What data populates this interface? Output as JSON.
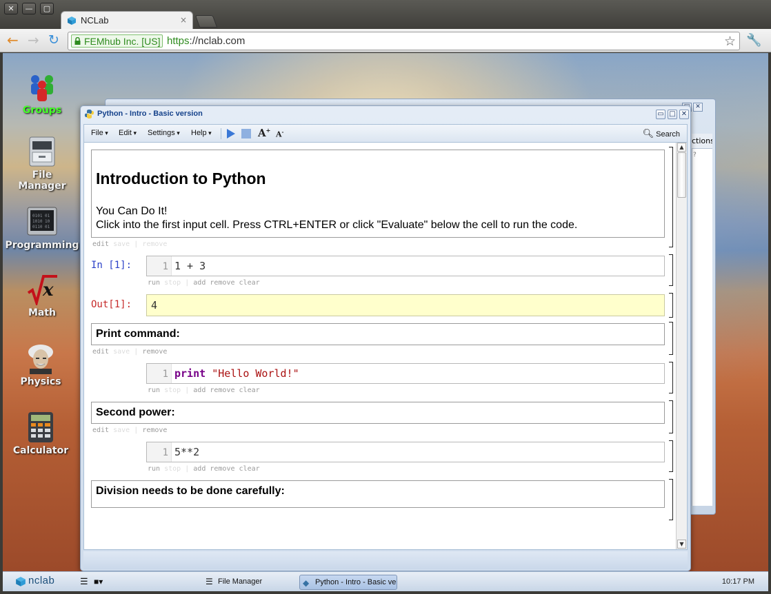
{
  "browser": {
    "tab_title": "NCLab",
    "tab_close": "×",
    "ev_label": "FEMhub Inc. [US]",
    "url_scheme": "https",
    "url_rest": "://nclab.com",
    "window_controls": [
      "✕",
      "—",
      "▢"
    ]
  },
  "desktop": {
    "icons": [
      {
        "label": "Groups",
        "icon": "groups-icon"
      },
      {
        "label": "File\nManager",
        "icon": "file-cabinet-icon"
      },
      {
        "label": "Programming",
        "icon": "terminal-icon"
      },
      {
        "label": "Math",
        "icon": "sqrt-x-icon"
      },
      {
        "label": "Physics",
        "icon": "einstein-icon"
      },
      {
        "label": "Calculator",
        "icon": "calculator-icon"
      }
    ],
    "back_window_header": "ctions",
    "back_window_sub": "?"
  },
  "window": {
    "title": "Python - Intro - Basic version",
    "menus": [
      "File",
      "Edit",
      "Settings",
      "Help"
    ],
    "search_label": "Search",
    "controls": [
      "▭",
      "□",
      "✕"
    ]
  },
  "notebook": {
    "intro_heading": "Introduction to Python",
    "intro_line1": "You Can Do It!",
    "intro_line2": "Click into the first input cell. Press CTRL+ENTER or click \"Evaluate\" below the cell to run the code.",
    "text_tools": {
      "edit": "edit",
      "save": "save",
      "sep": "|",
      "remove": "remove"
    },
    "code_tools": {
      "run": "run",
      "stop": "stop",
      "sep": "|",
      "add": "add",
      "remove": "remove",
      "clear": "clear"
    },
    "cell1_prompt": "In [1]:",
    "cell1_line": "1",
    "cell1_code": "1 + 3",
    "out1_prompt": "Out[1]:",
    "out1_value": "4",
    "print_heading": "Print command:",
    "cell2_line": "1",
    "cell2_kw": "print",
    "cell2_str": "\"Hello World!\"",
    "power_heading": "Second power:",
    "cell3_line": "1",
    "cell3_code": "5**2",
    "division_heading": "Division needs to be done carefully:"
  },
  "taskbar": {
    "brand": "nclab",
    "file_manager": "File Manager",
    "python_task": "Python - Intro - Basic ve",
    "clock": "10:17 PM"
  }
}
